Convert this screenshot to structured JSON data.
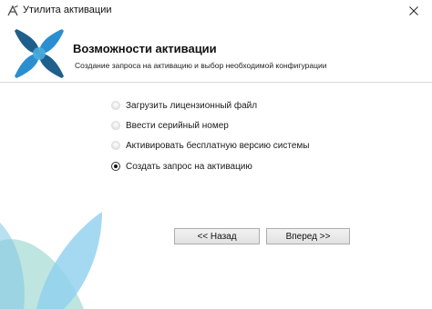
{
  "window": {
    "title": "Утилита активации",
    "app_icon": "activation-utility-icon",
    "close_icon": "close-icon"
  },
  "header": {
    "title": "Возможности активации",
    "subtitle": "Создание запроса на активацию и выбор необходимой конфигурации",
    "logo": "cross-leaf-logo"
  },
  "options": [
    {
      "label": "Загрузить лицензионный файл",
      "selected": false
    },
    {
      "label": "Ввести серийный номер",
      "selected": false
    },
    {
      "label": "Активировать бесплатную версию системы",
      "selected": false
    },
    {
      "label": "Создать запрос на активацию",
      "selected": true
    }
  ],
  "buttons": {
    "back_label": "<< Назад",
    "next_label": "Вперед >>"
  },
  "colors": {
    "accent_dark": "#1e5f8c",
    "accent_mid": "#2a8fcf",
    "accent_light": "#8fd0ef",
    "accent_teal": "#a8dcd6"
  }
}
